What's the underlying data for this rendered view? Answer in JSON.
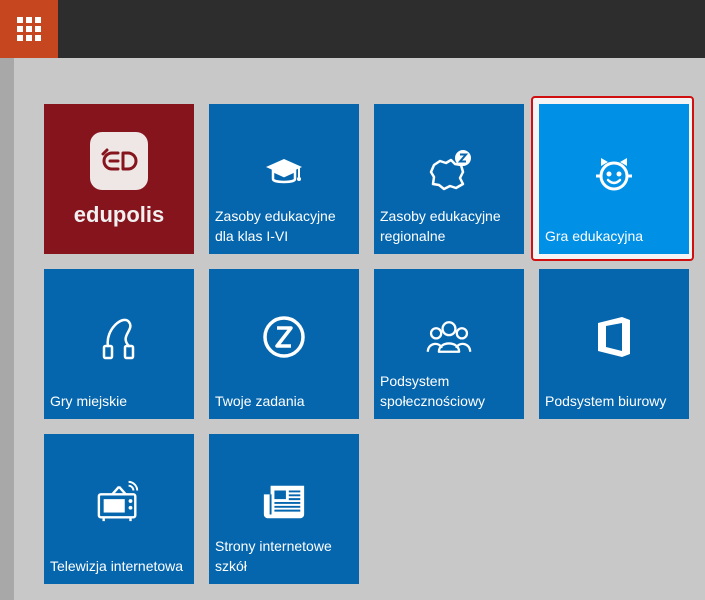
{
  "header": {
    "menu_icon": "apps-grid-icon"
  },
  "tiles": [
    {
      "name": "edupolis",
      "label": "",
      "brand_text": "edupolis",
      "icon": "edupolis-logo"
    },
    {
      "name": "zasoby-edukacyjne-1-6",
      "label": "Zasoby edukacyjne dla klas I-VI",
      "icon": "graduation-cap-icon"
    },
    {
      "name": "zasoby-edukacyjne-regionalne",
      "label": "Zasoby edukacyjne regionalne",
      "icon": "region-map-icon"
    },
    {
      "name": "gra-edukacyjna",
      "label": "Gra edukacyjna",
      "icon": "child-face-icon",
      "selected": true
    },
    {
      "name": "gry-miejskie",
      "label": "Gry miejskie",
      "icon": "jump-rope-icon"
    },
    {
      "name": "twoje-zadania",
      "label": "Twoje zadania",
      "icon": "z-circle-icon"
    },
    {
      "name": "podsystem-spolecznosciowy",
      "label": "Podsystem społecznościowy",
      "icon": "community-icon"
    },
    {
      "name": "podsystem-biurowy",
      "label": "Podsystem biurowy",
      "icon": "office-icon"
    },
    {
      "name": "telewizja-internetowa",
      "label": "Telewizja internetowa",
      "icon": "tv-icon"
    },
    {
      "name": "strony-internetowe-szkol",
      "label": "Strony internetowe szkół",
      "icon": "newspaper-icon"
    }
  ],
  "colors": {
    "topbar": "#2d2d2d",
    "menu_button": "#c6461f",
    "tile": "#0566ad",
    "tile_active": "#0090e6",
    "brand_tile": "#86141c",
    "selection_border": "#d01010"
  }
}
